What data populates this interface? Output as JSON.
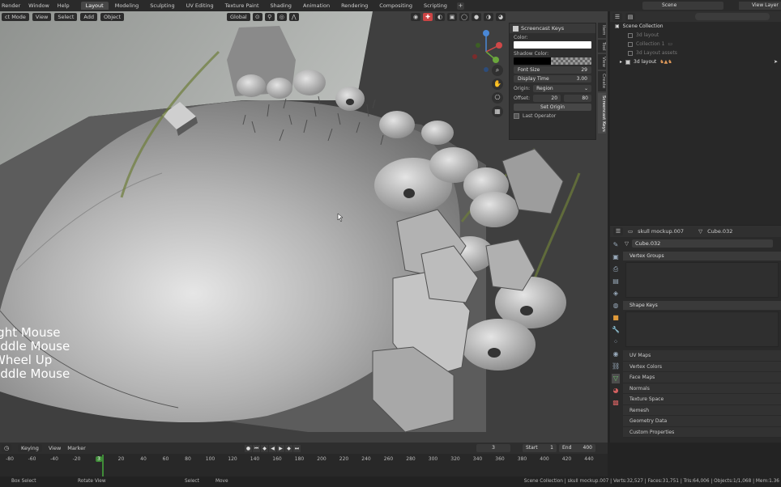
{
  "menu": [
    "Render",
    "Window",
    "Help"
  ],
  "workspaces": [
    "Layout",
    "Modeling",
    "Sculpting",
    "UV Editing",
    "Texture Paint",
    "Shading",
    "Animation",
    "Rendering",
    "Compositing",
    "Scripting"
  ],
  "active_workspace": "Layout",
  "scene_name": "Scene",
  "view_layer": "View Layer",
  "viewport": {
    "mode": "ct Mode",
    "menus": [
      "View",
      "Select",
      "Add",
      "Object"
    ],
    "orientation": "Global"
  },
  "screencast_lines": [
    "ight Mouse",
    "liddle Mouse",
    "Wheel Up",
    "liddle Mouse"
  ],
  "npanel": {
    "title": "Screencast Keys",
    "color_label": "Color:",
    "shadow_label": "Shadow Color:",
    "font_size_label": "Font Size",
    "font_size": "29",
    "display_time_label": "Display Time",
    "display_time": "3.00",
    "origin_label": "Origin:",
    "origin_value": "Region",
    "offset_label": "Offset:",
    "offset_x": "20",
    "offset_y": "80",
    "set_origin": "Set Origin",
    "last_operator": "Last Operator"
  },
  "npanel_tabs": [
    "Item",
    "Tool",
    "View",
    "Create",
    "Screencast Keys"
  ],
  "outliner": {
    "search_placeholder": "",
    "rows": [
      {
        "label": "Scene Collection",
        "dim": false
      },
      {
        "label": "3d layout",
        "dim": true
      },
      {
        "label": "Collection 1",
        "dim": true
      },
      {
        "label": "3d Layout assets",
        "dim": true
      },
      {
        "label": "3d layout",
        "dim": false
      }
    ]
  },
  "properties": {
    "object_name": "skull mockup.007",
    "mesh_name": "Cube.032",
    "data_field": "Cube.032",
    "vertex_groups": "Vertex Groups",
    "shape_keys": "Shape Keys",
    "sections": [
      "UV Maps",
      "Vertex Colors",
      "Face Maps",
      "Normals",
      "Texture Space",
      "Remesh",
      "Geometry Data",
      "Custom Properties"
    ]
  },
  "timeline": {
    "menus": [
      "Keying",
      "View",
      "Marker"
    ],
    "current_frame": "3",
    "start_label": "Start",
    "start": "1",
    "end_label": "End",
    "end": "400",
    "ticks": [
      "-80",
      "-60",
      "-40",
      "-20",
      "3",
      "20",
      "40",
      "60",
      "80",
      "100",
      "120",
      "140",
      "160",
      "180",
      "200",
      "220",
      "240",
      "260",
      "280",
      "300",
      "320",
      "340",
      "360",
      "380",
      "400",
      "420",
      "440"
    ]
  },
  "statusbar": {
    "box_select": "Box Select",
    "rotate_view": "Rotate View",
    "select": "Select",
    "move": "Move",
    "stats": "Scene Collection | skull mockup.007 | Verts:32,527 | Faces:31,751 | Tris:64,006 | Objects:1/1,068 | Mem:1.36"
  }
}
